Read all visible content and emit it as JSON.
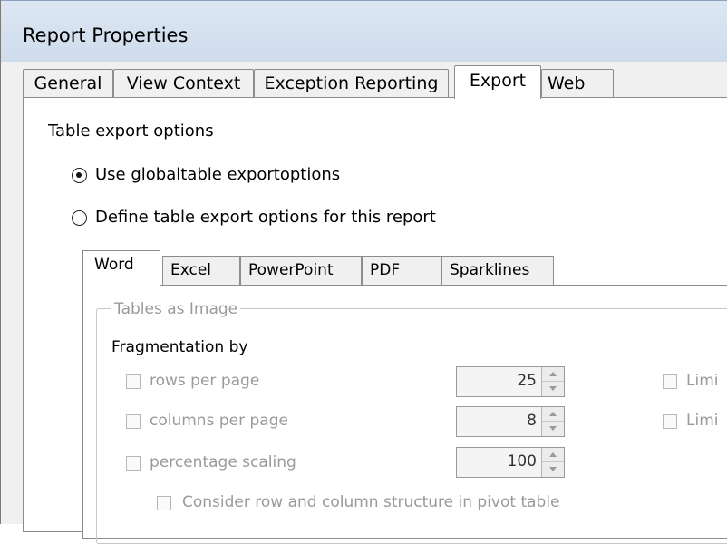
{
  "window": {
    "title": "Report Properties"
  },
  "tabs": [
    {
      "label": "General"
    },
    {
      "label": "View Context"
    },
    {
      "label": "Exception Reporting"
    },
    {
      "label": "Export"
    },
    {
      "label": "Web"
    }
  ],
  "export": {
    "section_label": "Table export options",
    "radio_global": "Use globaltable exportoptions",
    "radio_define": "Define table export options for this report",
    "selected_option": "global"
  },
  "subtabs": [
    {
      "label": "Word"
    },
    {
      "label": "Excel"
    },
    {
      "label": "PowerPoint"
    },
    {
      "label": "PDF"
    },
    {
      "label": "Sparklines"
    }
  ],
  "word": {
    "group_label": "Tables as Image",
    "fragmentation_label": "Fragmentation by",
    "rows_label": "rows per page",
    "rows_value": "25",
    "columns_label": "columns per page",
    "columns_value": "8",
    "scaling_label": "percentage scaling",
    "scaling_value": "100",
    "consider_label": "Consider row and column structure in pivot table",
    "limit_label_1": "Limi",
    "limit_label_2": "Limi"
  },
  "colors": {
    "title_bar": "#d6e2f0",
    "disabled_text": "#9a9a9a"
  },
  "icons": {
    "radio": "radio-button",
    "checkbox": "checkbox",
    "spinner": "spinner-arrows"
  }
}
